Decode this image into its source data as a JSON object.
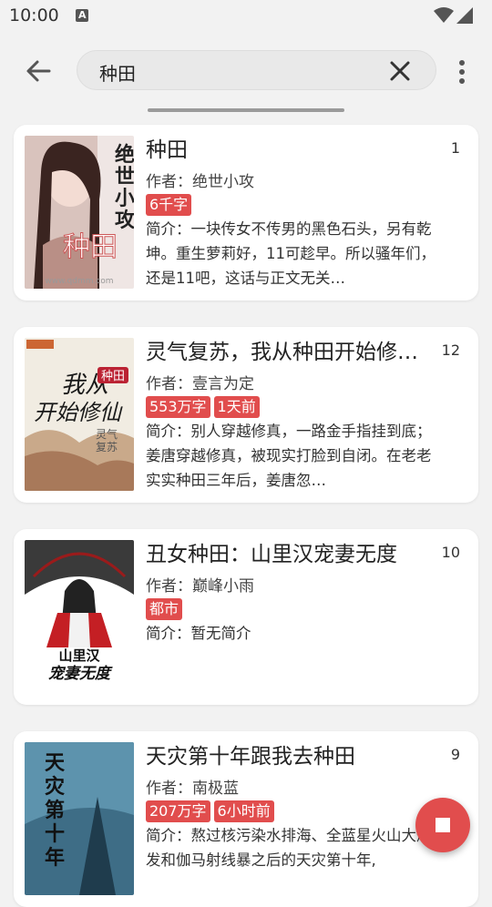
{
  "status_bar": {
    "time": "10:00"
  },
  "search": {
    "query": "种田"
  },
  "results": [
    {
      "title": "种田",
      "index": "1",
      "author": "作者：绝世小攻",
      "tags": [
        "6千字"
      ],
      "intro": "简介：一块传女不传男的黑色石头，另有乾坤。重生萝莉好，11可趁早。所以骚年们，还是11吧，这话与正文无关…",
      "cover_text": "绝世小攻 种田",
      "cover_site": "www.qdmm.com"
    },
    {
      "title": "灵气复苏，我从种田开始修…",
      "index": "12",
      "author": "作者：壹言为定",
      "tags": [
        "553万字",
        "1天前"
      ],
      "intro": "简介：别人穿越修真，一路金手指挂到底；姜唐穿越修真，被现实打脸到自闭。在老老实实种田三年后，姜唐忽…",
      "cover_text": "我从种田开始修仙"
    },
    {
      "title": "丑女种田：山里汉宠妻无度",
      "index": "10",
      "author": "作者：巅峰小雨",
      "tags": [
        "都市"
      ],
      "intro": "简介：暂无简介",
      "cover_text": "山里汉宠妻无度"
    },
    {
      "title": "天灾第十年跟我去种田",
      "index": "9",
      "author": "作者：南极蓝",
      "tags": [
        "207万字",
        "6小时前"
      ],
      "intro": "简介：熬过核污染水排海、全蓝星火山大爆发和伽马射线暴之后的天灾第十年,",
      "cover_text": "天灾第十年"
    }
  ],
  "colors": {
    "accent": "#e14d4d",
    "card": "#ffffff",
    "background": "#f2f2f2"
  },
  "icons": {
    "back": "arrow-left-icon",
    "clear": "close-icon",
    "more": "more-vert-icon",
    "fab": "stop-icon"
  }
}
